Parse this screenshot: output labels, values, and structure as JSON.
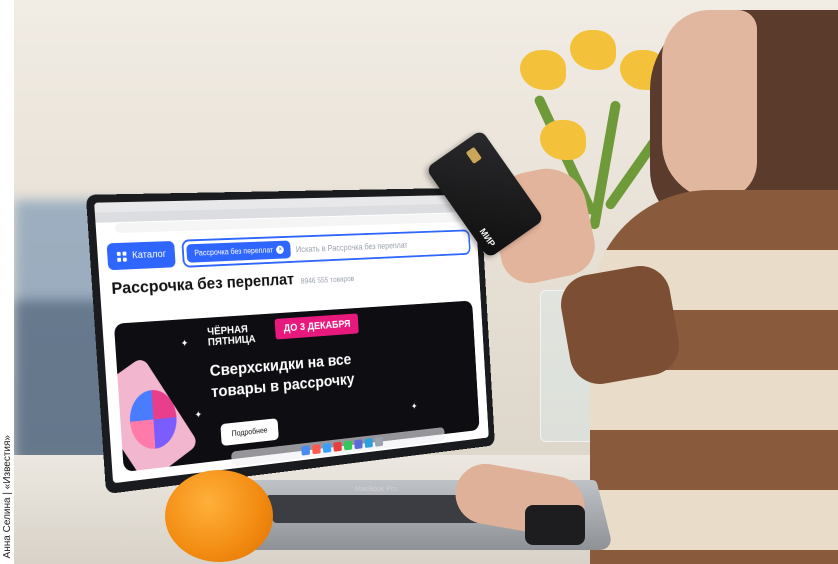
{
  "photo_credit": "Анна Селина | «Известия»",
  "card": {
    "brand": "МИР"
  },
  "laptop": {
    "model_label": "MacBook Pro"
  },
  "browser": {
    "catalog_button": "Каталог",
    "search_chip": "Рассрочка без переплат",
    "search_placeholder": "Искать в Рассрочка без переплат",
    "page_heading": "Рассрочка без переплат",
    "item_count": "8946 555 товаров"
  },
  "banner": {
    "badge": "ЧЁРНАЯ ПЯТНИЦА",
    "date_tag": "ДО 3 ДЕКАБРЯ",
    "headline": "Сверхскидки на все товары в рассрочку",
    "button_label": "Подробнее"
  },
  "colors": {
    "accent_blue": "#2e66ff",
    "banner_pink": "#e8197c",
    "orange": "#f28a10"
  }
}
